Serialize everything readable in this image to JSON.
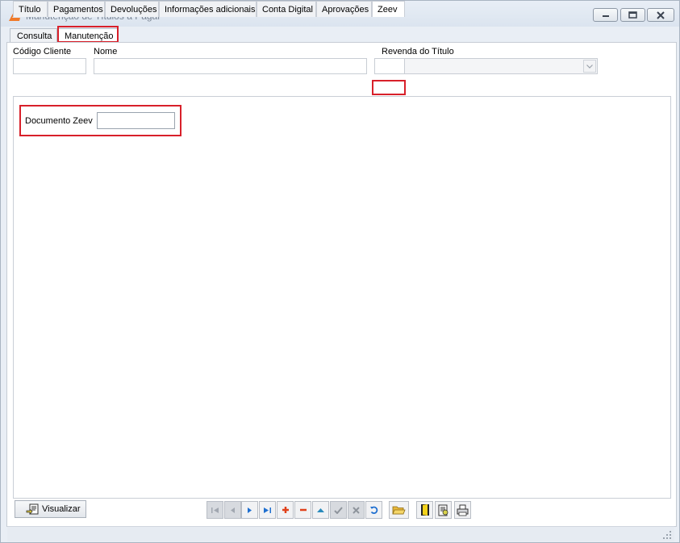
{
  "window": {
    "title": "Manutenção de Títulos a Pagar",
    "controls": {
      "minimize": "minimize-icon",
      "maximize": "maximize-icon",
      "close": "close-icon"
    }
  },
  "top_tabs": [
    {
      "label": "Consulta",
      "selected": false
    },
    {
      "label": "Manutenção",
      "selected": true
    }
  ],
  "header": {
    "codigo_cliente_label": "Código Cliente",
    "codigo_cliente_value": "",
    "nome_label": "Nome",
    "nome_value": "",
    "revenda_label": "Revenda do Título",
    "revenda_code_value": "",
    "revenda_select_value": ""
  },
  "sub_tabs": [
    {
      "label": "Título",
      "selected": false
    },
    {
      "label": "Pagamentos",
      "selected": false
    },
    {
      "label": "Devoluções",
      "selected": false
    },
    {
      "label": "Informações adicionais",
      "selected": false
    },
    {
      "label": "Conta Digital",
      "selected": false
    },
    {
      "label": "Aprovações",
      "selected": false
    },
    {
      "label": "Zeev",
      "selected": true
    }
  ],
  "zeev_panel": {
    "documento_label": "Documento Zeev",
    "documento_value": ""
  },
  "toolbar": {
    "visualizar_label": "Visualizar",
    "nav_buttons": [
      {
        "name": "first-record-button",
        "icon": "first-icon",
        "enabled": false
      },
      {
        "name": "prior-record-button",
        "icon": "prior-icon",
        "enabled": false
      },
      {
        "name": "next-record-button",
        "icon": "next-icon",
        "enabled": true
      },
      {
        "name": "last-record-button",
        "icon": "last-icon",
        "enabled": true
      },
      {
        "name": "insert-record-button",
        "icon": "plus-icon",
        "enabled": true
      },
      {
        "name": "delete-record-button",
        "icon": "minus-icon",
        "enabled": true
      },
      {
        "name": "edit-record-button",
        "icon": "up-triangle-icon",
        "enabled": true
      },
      {
        "name": "post-record-button",
        "icon": "check-icon",
        "enabled": false
      },
      {
        "name": "cancel-record-button",
        "icon": "cross-icon",
        "enabled": false
      },
      {
        "name": "refresh-button",
        "icon": "refresh-icon",
        "enabled": true
      },
      {
        "name": "open-folder-button",
        "icon": "folder-icon",
        "enabled": true
      },
      {
        "name": "exit-button",
        "icon": "door-icon",
        "enabled": true
      },
      {
        "name": "report-button",
        "icon": "report-icon",
        "enabled": true
      },
      {
        "name": "print-button",
        "icon": "printer-icon",
        "enabled": true
      }
    ]
  },
  "colors": {
    "highlight_red": "#d8202a",
    "nav_blue": "#1e6fd0",
    "add_red": "#e0401a"
  }
}
